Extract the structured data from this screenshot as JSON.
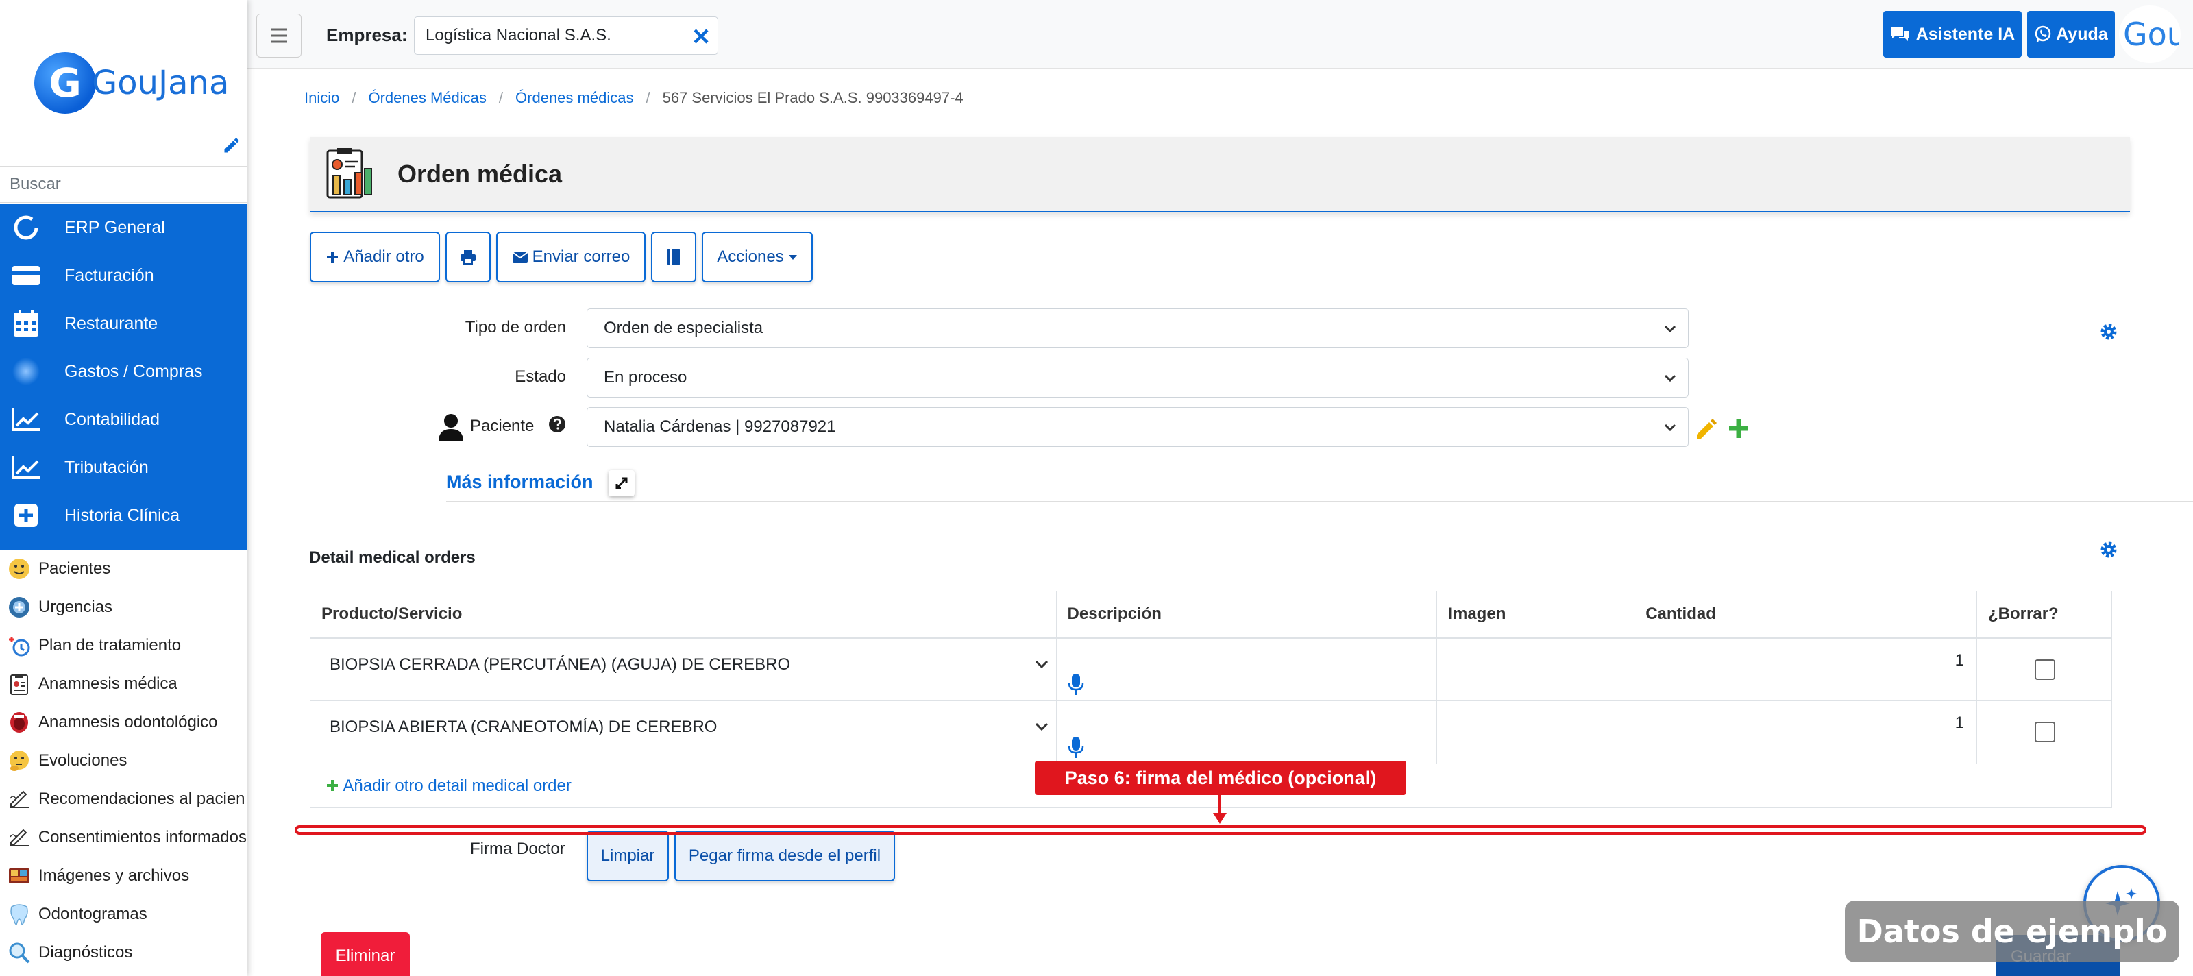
{
  "sidebar": {
    "logo_text": "GouJana",
    "logo_letter": "G",
    "search_placeholder": "Buscar",
    "menu": [
      {
        "label": "ERP General",
        "icon": "circle-refresh-icon"
      },
      {
        "label": "Facturación",
        "icon": "credit-card-icon"
      },
      {
        "label": "Restaurante",
        "icon": "calendar-icon"
      },
      {
        "label": "Gastos / Compras",
        "icon": "blur-circle-icon"
      },
      {
        "label": "Contabilidad",
        "icon": "chart-line-icon"
      },
      {
        "label": "Tributación",
        "icon": "chart-line-icon"
      },
      {
        "label": "Historia Clínica",
        "icon": "plus-square-icon"
      }
    ],
    "submenu": [
      {
        "label": "Pacientes",
        "icon": "smiley-icon"
      },
      {
        "label": "Urgencias",
        "icon": "ambulance-icon"
      },
      {
        "label": "Plan de tratamiento",
        "icon": "stethoscope-icon"
      },
      {
        "label": "Anamnesis médica",
        "icon": "clipboard-icon"
      },
      {
        "label": "Anamnesis odontológico",
        "icon": "mouth-icon"
      },
      {
        "label": "Evoluciones",
        "icon": "thinking-face-icon"
      },
      {
        "label": "Recomendaciones al pacien",
        "icon": "signature-icon"
      },
      {
        "label": "Consentimientos informados",
        "icon": "signature-icon"
      },
      {
        "label": "Imágenes y archivos",
        "icon": "images-icon"
      },
      {
        "label": "Odontogramas",
        "icon": "tooth-icon"
      },
      {
        "label": "Diagnósticos",
        "icon": "magnifier-icon"
      }
    ]
  },
  "topbar": {
    "empresa_label": "Empresa:",
    "empresa_value": "Logística Nacional S.A.S.",
    "ai_button": "Asistente IA",
    "help_button": "Ayuda",
    "avatar_text": "Gou"
  },
  "breadcrumb": {
    "items": [
      "Inicio",
      "Órdenes Médicas",
      "Órdenes médicas"
    ],
    "current": "567 Servicios El Prado S.A.S. 9903369497-4"
  },
  "page": {
    "title": "Orden médica"
  },
  "toolbar": {
    "add_label": "Añadir otro",
    "email_label": "Enviar correo",
    "actions_label": "Acciones"
  },
  "form": {
    "tipo_label": "Tipo de orden",
    "tipo_value": "Orden de especialista",
    "estado_label": "Estado",
    "estado_value": "En proceso",
    "paciente_label": "Paciente",
    "paciente_value": "Natalia Cárdenas | 9927087921",
    "mas_info": "Más información"
  },
  "detail": {
    "title": "Detail medical orders",
    "headers": [
      "Producto/Servicio",
      "Descripción",
      "Imagen",
      "Cantidad",
      "¿Borrar?"
    ],
    "rows": [
      {
        "product": "BIOPSIA CERRADA (PERCUTÁNEA) (AGUJA) DE CEREBRO",
        "quantity": "1"
      },
      {
        "product": "BIOPSIA ABIERTA (CRANEOTOMÍA) DE CEREBRO",
        "quantity": "1"
      }
    ],
    "add_row": "Añadir otro detail medical order"
  },
  "firma": {
    "label": "Firma Doctor",
    "clear_button": "Limpiar",
    "paste_button": "Pegar firma desde el perfil"
  },
  "annotation": {
    "callout": "Paso 6: firma del médico (opcional)"
  },
  "footer": {
    "delete_button": "Eliminar",
    "save_button": "Guardar",
    "watermark": "Datos de ejemplo"
  },
  "colors": {
    "primary": "#0a6ad6",
    "danger": "#f01d3a",
    "annotation": "#e0161e",
    "edit_pencil": "#f0b400",
    "add_plus": "#3cb043"
  }
}
